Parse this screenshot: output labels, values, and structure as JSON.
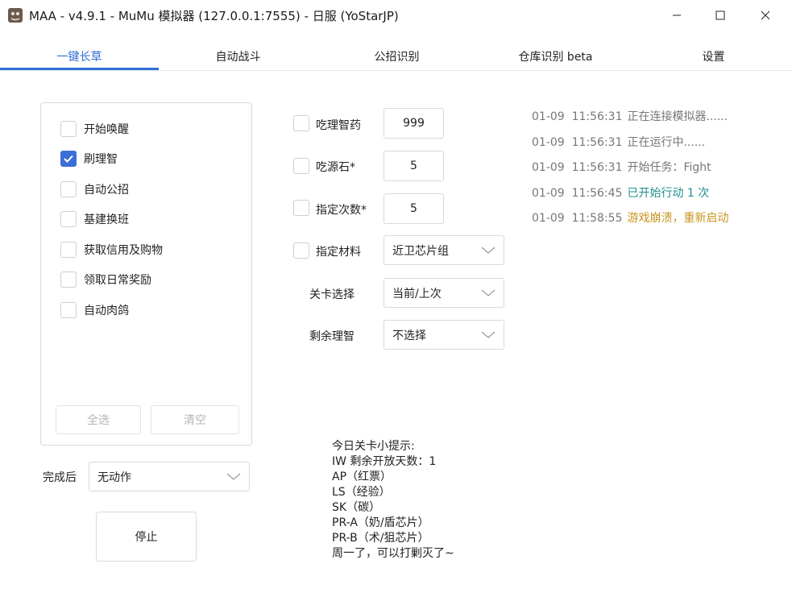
{
  "window": {
    "title": "MAA - v4.9.1 - MuMu 模拟器 (127.0.0.1:7555) - 日服 (YoStarJP)",
    "icon": "maa-app-icon"
  },
  "tabs": [
    {
      "label": "一键长草",
      "active": true
    },
    {
      "label": "自动战斗",
      "active": false
    },
    {
      "label": "公招识别",
      "active": false
    },
    {
      "label": "仓库识别 beta",
      "active": false
    },
    {
      "label": "设置",
      "active": false
    }
  ],
  "tasks": [
    {
      "label": "开始唤醒",
      "checked": false
    },
    {
      "label": "刷理智",
      "checked": true
    },
    {
      "label": "自动公招",
      "checked": false
    },
    {
      "label": "基建换班",
      "checked": false
    },
    {
      "label": "获取信用及购物",
      "checked": false
    },
    {
      "label": "领取日常奖励",
      "checked": false
    },
    {
      "label": "自动肉鸽",
      "checked": false
    }
  ],
  "task_buttons": {
    "select_all": "全选",
    "clear": "清空"
  },
  "after_complete": {
    "label": "完成后",
    "value": "无动作"
  },
  "stop_button": "停止",
  "settings": {
    "medicine": {
      "label": "吃理智药",
      "checked": false,
      "value": "999"
    },
    "stone": {
      "label": "吃源石*",
      "checked": false,
      "value": "5"
    },
    "times": {
      "label": "指定次数*",
      "checked": false,
      "value": "5"
    },
    "material": {
      "label": "指定材料",
      "checked": false,
      "value": "近卫芯片组"
    },
    "stage": {
      "label": "关卡选择",
      "value": "当前/上次"
    },
    "remaining": {
      "label": "剩余理智",
      "value": "不选择"
    }
  },
  "log": [
    {
      "date": "01-09",
      "time": "11:56:31",
      "message": "正在连接模拟器......",
      "color": "#777777"
    },
    {
      "date": "01-09",
      "time": "11:56:31",
      "message": "正在运行中......",
      "color": "#777777"
    },
    {
      "date": "01-09",
      "time": "11:56:31",
      "message": "开始任务：Fight",
      "color": "#777777"
    },
    {
      "date": "01-09",
      "time": "11:56:45",
      "message": "已开始行动 1 次",
      "color": "#1f8f8f"
    },
    {
      "date": "01-09",
      "time": "11:58:55",
      "message": "游戏崩溃，重新启动",
      "color": "#c8941e"
    }
  ],
  "tips": [
    "今日关卡小提示:",
    "IW 剩余开放天数：1",
    "AP（红票）",
    "LS（经验）",
    "SK（碳）",
    "PR-A（奶/盾芯片）",
    "PR-B（术/狙芯片）",
    "周一了，可以打剿灭了~"
  ],
  "colors": {
    "accent": "#2f6fd7",
    "checkbox_checked": "#3a6fd8"
  }
}
